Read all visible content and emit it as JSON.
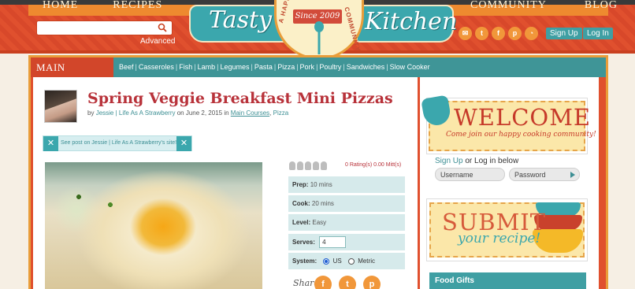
{
  "header": {
    "nav_left": [
      "HOME",
      "RECIPES"
    ],
    "nav_right": [
      "COMMUNITY",
      "BLOG"
    ],
    "search": {
      "placeholder": "",
      "advanced_label": "Advanced"
    },
    "logo": {
      "left": "Tasty",
      "right": "Kitchen",
      "since": "Since 2009",
      "arc_left": "A HAPPY",
      "arc_right": "COMMUNITY"
    },
    "social": [
      "mail",
      "twitter",
      "facebook",
      "pinterest",
      "rss"
    ],
    "signup_label": "Sign Up",
    "login_label": "Log In"
  },
  "category": {
    "title": "MAIN COURSES",
    "links": [
      "Beef",
      "Casseroles",
      "Fish",
      "Lamb",
      "Legumes",
      "Pasta",
      "Pizza",
      "Pork",
      "Poultry",
      "Sandwiches",
      "Slow Cooker"
    ]
  },
  "post": {
    "title": "Spring Veggie Breakfast Mini Pizzas",
    "by": "by",
    "author": "Jessie | Life As A Strawberry",
    "on_date": "on June 2, 2015 in",
    "cat1": "Main Courses",
    "comma": ",",
    "cat2": "Pizza",
    "see_post": "See post on Jessie | Life As A Strawberry's site!",
    "rating_text": "0 Rating(s)  0.00 Mitt(s)",
    "prep_label": "Prep:",
    "prep_value": "10 mins",
    "cook_label": "Cook:",
    "cook_value": "20 mins",
    "level_label": "Level:",
    "level_value": "Easy",
    "serves_label": "Serves:",
    "serves_value": "4",
    "system_label": "System:",
    "system_us": "US",
    "system_metric": "Metric",
    "share_label": "Share"
  },
  "sidebar": {
    "welcome": "WELCOME",
    "welcome_sub": "Come join our happy cooking community!",
    "signup_link": "Sign Up",
    "signup_rest": " or Log in below",
    "username_placeholder": "Username",
    "password_placeholder": "Password",
    "submit": "SUBMIT",
    "submit_sub": "your recipe!",
    "food_gifts": "Food Gifts"
  },
  "colors": {
    "accent": "#3ba7ad",
    "brand_red": "#e0502e",
    "orange": "#f1973a",
    "title_red": "#b8323a"
  }
}
